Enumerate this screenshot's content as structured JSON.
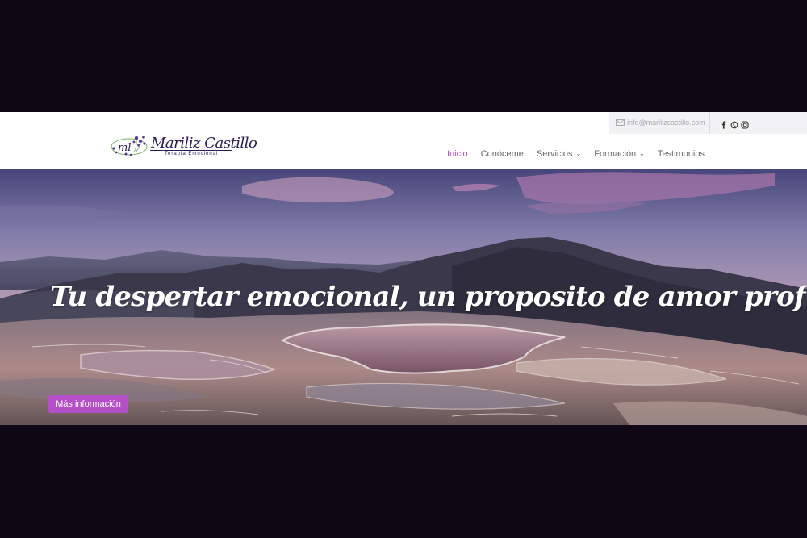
{
  "topbar": {
    "email": "info@marilizcastillo.com",
    "social_icons": [
      "facebook-icon",
      "whatsapp-icon",
      "instagram-icon"
    ]
  },
  "logo": {
    "name": "Mariliz Castillo",
    "tagline": "Terapia Emocional"
  },
  "nav": {
    "items": [
      {
        "label": "Inicio",
        "active": true
      },
      {
        "label": "Conóceme"
      },
      {
        "label": "Servicios",
        "dropdown": true
      },
      {
        "label": "Formación",
        "dropdown": true
      },
      {
        "label": "Testimonios"
      }
    ]
  },
  "hero": {
    "headline": "Tu despertar emocional, un proposito de amor profundo",
    "cta": "Más información"
  },
  "colors": {
    "accent": "#b44fc7",
    "logo": "#2a1a55",
    "frame": "#0f0814"
  }
}
